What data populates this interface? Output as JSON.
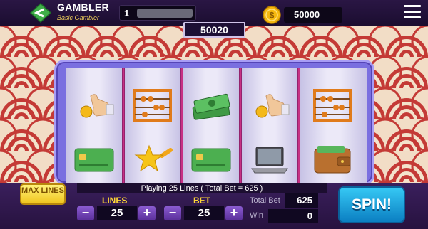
{
  "header": {
    "rank_title": "GAMBLER",
    "rank_subtitle": "Basic Gambler",
    "level": "1",
    "xp_progress": 0.0,
    "coins": "50000",
    "icons": [
      "gambler-badge-icon",
      "coin-icon",
      "hamburger-menu-icon"
    ]
  },
  "win_display": "50020",
  "reels": [
    [
      "pointing-hand-coin-icon",
      "credit-card-icon"
    ],
    [
      "abacus-icon",
      "shooting-star-icon"
    ],
    [
      "money-stack-icon",
      "credit-card-icon"
    ],
    [
      "pointing-hand-coin-icon",
      "laptop-icon"
    ],
    [
      "abacus-icon",
      "wallet-icon"
    ]
  ],
  "controls": {
    "max_lines": "MAX LINES",
    "status_text": "Playing 25 Lines ( Total Bet = 625 )",
    "lines_label": "LINES",
    "lines_value": "25",
    "bet_label": "BET",
    "bet_value": "25",
    "minus": "−",
    "plus": "+",
    "total_bet_label": "Total Bet",
    "total_bet_value": "625",
    "win_label": "Win",
    "win_value": "0",
    "spin_label": "SPIN!"
  },
  "colors": {
    "topbar": "#2a1644",
    "frame": "#7a6fe0",
    "reel_separator": "#e0398f",
    "gold": "#ffd736",
    "spin": "#1aa3e0"
  }
}
